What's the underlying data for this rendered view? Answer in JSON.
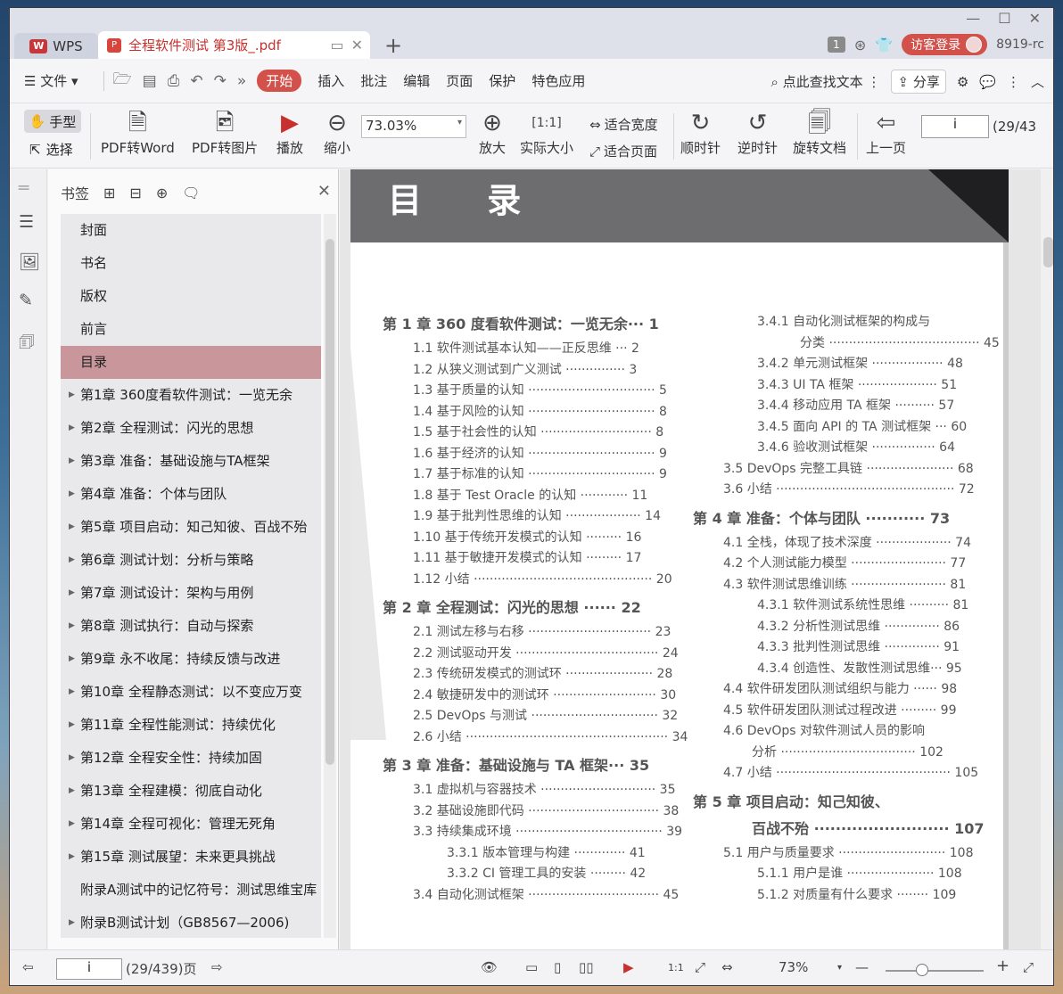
{
  "tabs": {
    "app": "WPS",
    "doc_title": "全程软件测试 第3版_.pdf",
    "badge": "1",
    "login": "访客登录",
    "version": "8919-rc"
  },
  "menu": {
    "file": "文件",
    "items": [
      "开始",
      "插入",
      "批注",
      "编辑",
      "页面",
      "保护",
      "特色应用"
    ],
    "search": "点此查找文本",
    "share": "分享"
  },
  "toolbar": {
    "hand": "手型",
    "select": "选择",
    "pdf2word": "PDF转Word",
    "pdf2img": "PDF转图片",
    "play": "播放",
    "zoom_out": "缩小",
    "zoom_value": "73.03%",
    "zoom_in": "放大",
    "actual": "实际大小",
    "fit_width": "适合宽度",
    "fit_page": "适合页面",
    "cw": "顺时针",
    "ccw": "逆时针",
    "rotate": "旋转文档",
    "prev": "上一页",
    "page_input": "i",
    "page_count": "(29/43"
  },
  "bookmarks": {
    "title": "书签",
    "items": [
      {
        "label": "封面",
        "expand": false
      },
      {
        "label": "书名",
        "expand": false
      },
      {
        "label": "版权",
        "expand": false
      },
      {
        "label": "前言",
        "expand": false
      },
      {
        "label": "目录",
        "expand": false
      },
      {
        "label": "第1章  360度看软件测试：一览无余",
        "expand": true
      },
      {
        "label": "第2章  全程测试：闪光的思想",
        "expand": true
      },
      {
        "label": "第3章  准备：基础设施与TA框架",
        "expand": true
      },
      {
        "label": "第4章  准备：个体与团队",
        "expand": true
      },
      {
        "label": "第5章  项目启动：知己知彼、百战不殆",
        "expand": true
      },
      {
        "label": "第6章  测试计划：分析与策略",
        "expand": true
      },
      {
        "label": "第7章  测试设计：架构与用例",
        "expand": true
      },
      {
        "label": "第8章  测试执行：自动与探索",
        "expand": true
      },
      {
        "label": "第9章  永不收尾：持续反馈与改进",
        "expand": true
      },
      {
        "label": "第10章  全程静态测试：以不变应万变",
        "expand": true
      },
      {
        "label": "第11章  全程性能测试：持续优化",
        "expand": true
      },
      {
        "label": "第12章  全程安全性：持续加固",
        "expand": true
      },
      {
        "label": "第13章  全程建模：彻底自动化",
        "expand": true
      },
      {
        "label": "第14章  全程可视化：管理无死角",
        "expand": true
      },
      {
        "label": "第15章  测试展望：未来更具挑战",
        "expand": true
      },
      {
        "label": "附录A测试中的记忆符号：测试思维宝库",
        "expand": false
      },
      {
        "label": "附录B测试计划（GB8567—2006)",
        "expand": true
      }
    ]
  },
  "page": {
    "heading": "目  录",
    "left": [
      {
        "t": "第 1 章    360 度看软件测试：一览无余···  1",
        "ch": true
      },
      {
        "t": "1.1   软件测试基本认知——正反思维 ···  2"
      },
      {
        "t": "1.2   从狭义测试到广义测试 ···············  3"
      },
      {
        "t": "1.3   基于质量的认知 ································  5"
      },
      {
        "t": "1.4   基于风险的认知 ································  8"
      },
      {
        "t": "1.5   基于社会性的认知 ····························  8"
      },
      {
        "t": "1.6   基于经济的认知 ································  9"
      },
      {
        "t": "1.7   基于标准的认知 ································  9"
      },
      {
        "t": "1.8   基于 Test Oracle 的认知  ············ 11"
      },
      {
        "t": "1.9   基于批判性思维的认知 ··················· 14"
      },
      {
        "t": "1.10   基于传统开发模式的认知  ········· 16"
      },
      {
        "t": "1.11   基于敏捷开发模式的认知  ········· 17"
      },
      {
        "t": "1.12   小结  ············································· 20"
      },
      {
        "t": "第 2 章    全程测试：闪光的思想   ······   22",
        "ch": true
      },
      {
        "t": "2.1   测试左移与右移 ······························· 23"
      },
      {
        "t": "2.2   测试驱动开发 ···································· 24"
      },
      {
        "t": "2.3   传统研发模式的测试环 ······················ 28"
      },
      {
        "t": "2.4   敏捷研发中的测试环 ·························· 30"
      },
      {
        "t": "2.5   DevOps 与测试  ································ 32"
      },
      {
        "t": "2.6   小结 ··················································· 34"
      },
      {
        "t": "第 3 章    准备：基础设施与 TA 框架···   35",
        "ch": true
      },
      {
        "t": "3.1   虚拟机与容器技术 ····························· 35"
      },
      {
        "t": "3.2   基础设施即代码 ································· 38"
      },
      {
        "t": "3.3   持续集成环境 ····································· 39"
      },
      {
        "t": "3.3.1   版本管理与构建  ············· 41",
        "ind": true
      },
      {
        "t": "3.3.2   CI 管理工具的安装 ········· 42",
        "ind": true
      },
      {
        "t": "3.4   自动化测试框架 ································· 45"
      }
    ],
    "right": [
      {
        "t": "3.4.1   自动化测试框架的构成与",
        "ind": true
      },
      {
        "t": "分类  ······································ 45",
        "ind2": true
      },
      {
        "t": "3.4.2   单元测试框架  ·················· 48",
        "ind": true
      },
      {
        "t": "3.4.3   UI TA 框架   ···················· 51",
        "ind": true
      },
      {
        "t": "3.4.4   移动应用 TA 框架   ·········· 57",
        "ind": true
      },
      {
        "t": "3.4.5   面向 API 的 TA 测试框架 ··· 60",
        "ind": true
      },
      {
        "t": "3.4.6   验收测试框架   ················ 64",
        "ind": true
      },
      {
        "t": "3.5   DevOps 完整工具链 ······················ 68"
      },
      {
        "t": "3.6   小结 ············································· 72"
      },
      {
        "t": "第 4 章    准备：个体与团队   ···········   73",
        "ch": true
      },
      {
        "t": "4.1   全栈，体现了技术深度 ··················· 74"
      },
      {
        "t": "4.2   个人测试能力模型 ························ 77"
      },
      {
        "t": "4.3   软件测试思维训练 ························ 81"
      },
      {
        "t": "4.3.1   软件测试系统性思维   ·········· 81",
        "ind": true
      },
      {
        "t": "4.3.2   分析性测试思维   ·············· 86",
        "ind": true
      },
      {
        "t": "4.3.3   批判性测试思维   ·············· 91",
        "ind": true
      },
      {
        "t": "4.3.4   创造性、发散性测试思维··· 95",
        "ind": true
      },
      {
        "t": "4.4   软件研发团队测试组织与能力 ······ 98"
      },
      {
        "t": "4.5   软件研发团队测试过程改进 ········· 99"
      },
      {
        "t": "4.6   DevOps 对软件测试人员的影响"
      },
      {
        "t": "分析 ·································· 102",
        "ind1": true
      },
      {
        "t": "4.7   小结 ············································ 105"
      },
      {
        "t": "第 5 章    项目启动：知己知彼、",
        "ch": true
      },
      {
        "t": "百战不殆   ························· 107",
        "ch": true,
        "ind1": true
      },
      {
        "t": "5.1   用户与质量要求 ··························· 108"
      },
      {
        "t": "5.1.1   用户是谁   ······················ 108",
        "ind": true
      },
      {
        "t": "5.1.2   对质量有什么要求   ········ 109",
        "ind": true
      }
    ]
  },
  "status": {
    "page_input": "i",
    "page_count": "(29/439)页",
    "zoom": "73%"
  }
}
